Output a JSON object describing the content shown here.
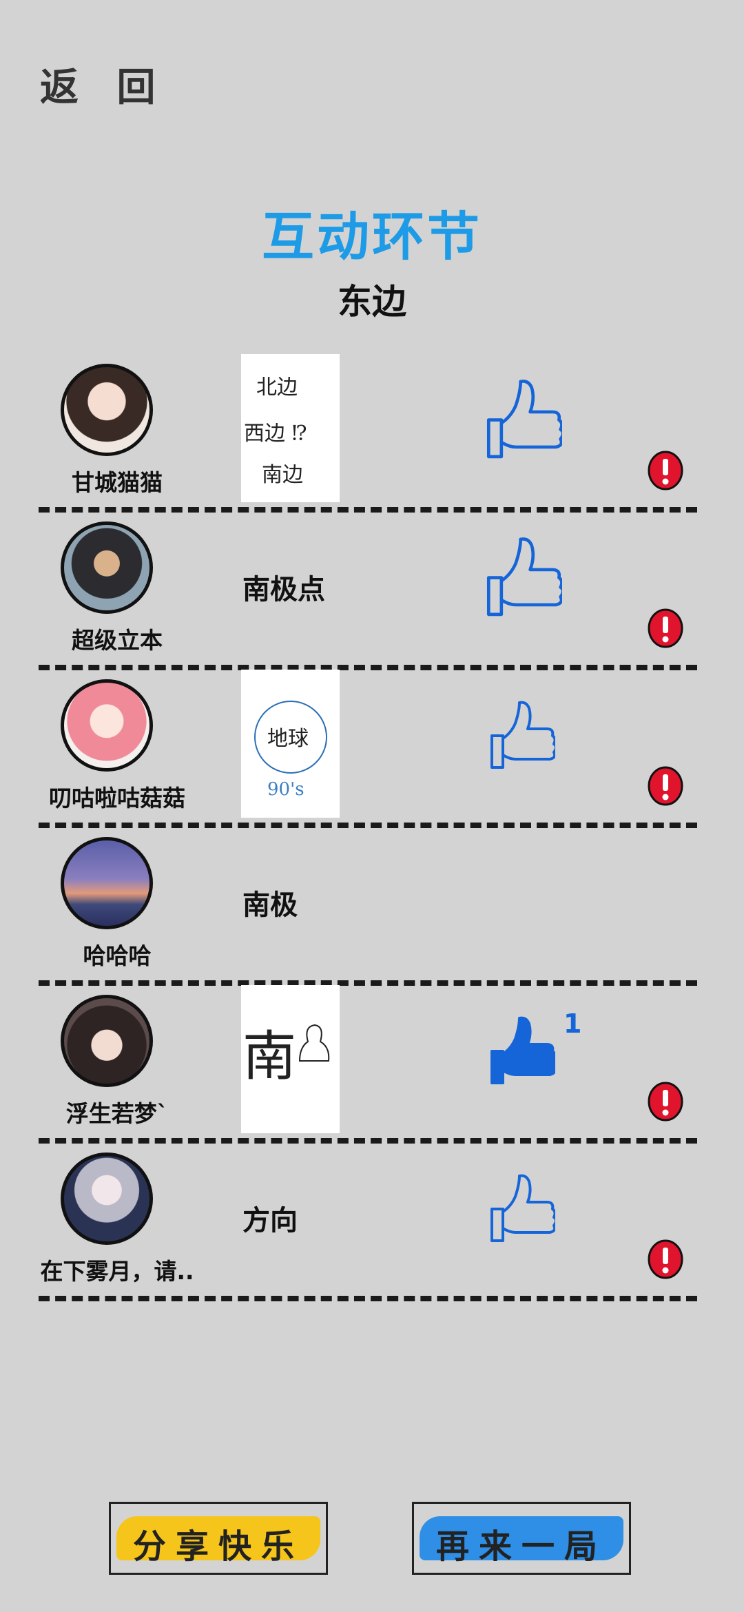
{
  "header": {
    "back_label": "返 回"
  },
  "title": "互动环节",
  "answer": "东边",
  "players": [
    {
      "name": "甘城猫猫",
      "drawing_text": "北边 西边 ?? 南边",
      "liked": false,
      "likes": ""
    },
    {
      "name": "超级立本",
      "word": "南极点",
      "liked": false,
      "likes": ""
    },
    {
      "name": "叨咕啦咕菇菇",
      "drawing_text": "地球 90's",
      "liked": false,
      "likes": ""
    },
    {
      "name": "哈哈哈",
      "word": "南极"
    },
    {
      "name": "浮生若梦`",
      "drawing_text": "南",
      "liked": true,
      "likes": "1"
    },
    {
      "name": "在下雾月，请..",
      "word": "方向",
      "liked": false,
      "likes": ""
    }
  ],
  "buttons": {
    "share": "分享快乐",
    "again": "再来一局"
  },
  "colors": {
    "accent": "#1e9be6",
    "like": "#1565d8",
    "report": "#e0142c",
    "share_paint": "#f6c51c",
    "again_paint": "#2f8ee6"
  }
}
